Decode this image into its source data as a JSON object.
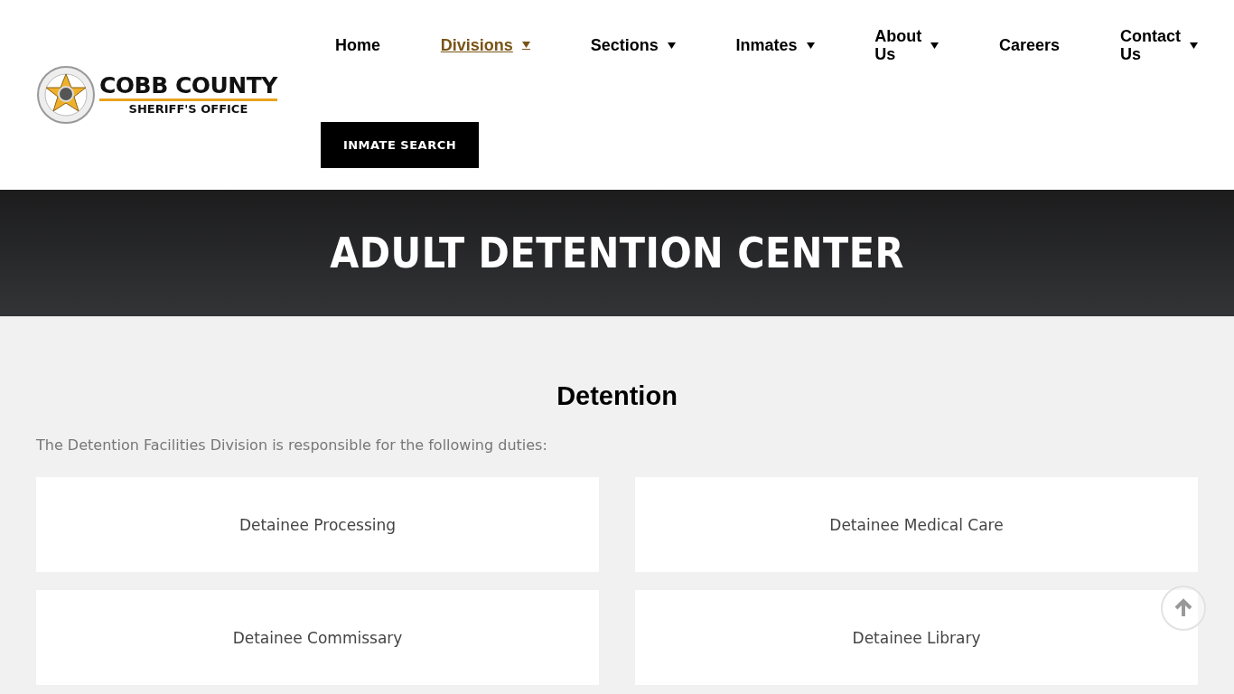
{
  "logo": {
    "title": "COBB COUNTY",
    "subtitle": "SHERIFF'S OFFICE"
  },
  "nav": [
    {
      "label": "Home",
      "selected": false,
      "dropdown": false
    },
    {
      "label": "Divisions",
      "selected": true,
      "dropdown": true
    },
    {
      "label": "Sections",
      "selected": false,
      "dropdown": true
    },
    {
      "label": "Inmates",
      "selected": false,
      "dropdown": true
    },
    {
      "label": "About Us",
      "selected": false,
      "dropdown": true
    },
    {
      "label": "Careers",
      "selected": false,
      "dropdown": false
    },
    {
      "label": "Contact Us",
      "selected": false,
      "dropdown": true
    }
  ],
  "cta": "INMATE SEARCH",
  "hero": {
    "title": "ADULT DETENTION CENTER"
  },
  "section": {
    "heading": "Detention",
    "intro": "The Detention Facilities Division is responsible for the following duties:",
    "cards": [
      "Detainee Processing",
      "Detainee Medical Care",
      "Detainee Commissary",
      "Detainee Library"
    ]
  }
}
